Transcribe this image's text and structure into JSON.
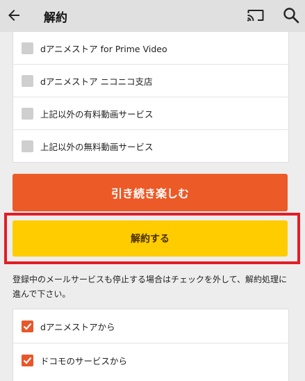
{
  "header": {
    "title": "解約"
  },
  "icons": {
    "back": "arrow-back-icon",
    "cast": "cast-icon",
    "search": "search-icon"
  },
  "services": [
    {
      "label": "dアニメストア for Prime Video",
      "checked": false
    },
    {
      "label": "dアニメストア ニコニコ支店",
      "checked": false
    },
    {
      "label": "上記以外の有料動画サービス",
      "checked": false
    },
    {
      "label": "上記以外の無料動画サービス",
      "checked": false
    }
  ],
  "buttons": {
    "continue": "引き続き楽しむ",
    "cancel": "解約する"
  },
  "note": "登録中のメールサービスも停止する場合はチェックを外して、解約処理に進んで下さい。",
  "mail": [
    {
      "label": "dアニメストアから",
      "checked": true
    },
    {
      "label": "ドコモのサービスから",
      "checked": true
    }
  ],
  "colors": {
    "accent_orange": "#ec5a27",
    "accent_yellow": "#ffcc00",
    "highlight_red": "#e21d26"
  }
}
